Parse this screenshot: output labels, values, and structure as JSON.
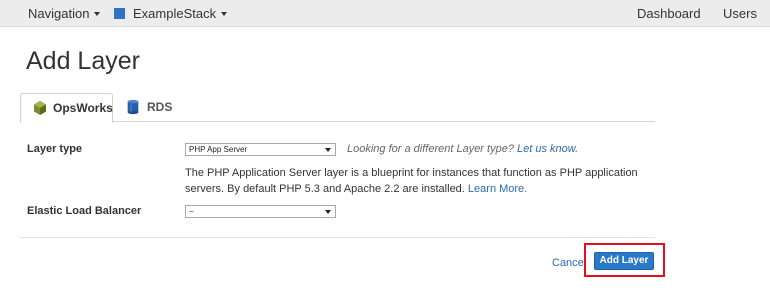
{
  "topnav": {
    "navigation_label": "Navigation",
    "stack_label": "ExampleStack",
    "dashboard_label": "Dashboard",
    "users_label": "Users",
    "stack_color": "#2d74c7"
  },
  "page": {
    "title": "Add Layer"
  },
  "tabs": [
    {
      "label": "OpsWorks",
      "icon": "opsworks-icon",
      "active": true
    },
    {
      "label": "RDS",
      "icon": "rds-database-icon",
      "active": false
    }
  ],
  "form": {
    "layer_type_label": "Layer type",
    "layer_type_value": "PHP App Server",
    "hint_text": "Looking for a different Layer type?",
    "hint_link": "Let us know.",
    "description": "The PHP Application Server layer is a blueprint for instances that function as PHP application servers. By default PHP 5.3 and Apache 2.2 are installed.",
    "learn_more": "Learn More.",
    "elb_label": "Elastic Load Balancer",
    "elb_value": "–"
  },
  "actions": {
    "cancel_label": "Cancel",
    "add_label": "Add Layer",
    "primary_color": "#2a78c8",
    "highlight_color": "#e3101b"
  }
}
